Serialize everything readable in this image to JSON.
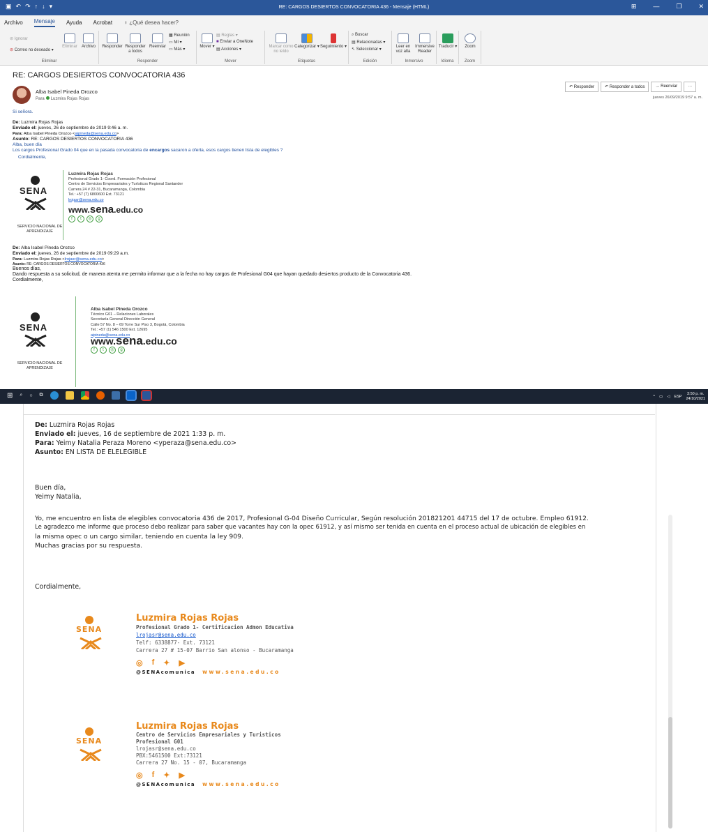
{
  "window": {
    "title": "RE: CARGOS DESIERTOS CONVOCATORIA 436 - Mensaje (HTML)"
  },
  "menu": {
    "tabs": [
      "Archivo",
      "Mensaje",
      "Ayuda",
      "Acrobat"
    ],
    "active": "Mensaje",
    "search_placeholder": "¿Qué desea hacer?"
  },
  "ribbon": {
    "groups": {
      "eliminar": "Eliminar",
      "responder": "Responder",
      "mover": "Mover",
      "etiquetas": "Etiquetas",
      "edicion": "Edición",
      "inmersivo": "Inmersivo",
      "idioma": "Idioma",
      "zoom": "Zoom"
    },
    "ignorar": "Ignorar",
    "correo_no_deseado": "Correo no deseado",
    "eliminar_btn": "Eliminar",
    "archivo_btn": "Archivo",
    "responder_btn": "Responder",
    "responder_todos": "Responder a todos",
    "reenviar": "Reenviar",
    "reunion": "Reunión",
    "mi": "MI",
    "mas": "Más",
    "mover_btn": "Mover",
    "reglas": "Reglas",
    "onenote": "Enviar a OneNote",
    "acciones": "Acciones",
    "marcar_no_leido": "Marcar como no leído",
    "categorizar": "Categorizar",
    "seguimiento": "Seguimiento",
    "buscar": "Buscar",
    "relacionadas": "Relacionadas",
    "seleccionar": "Seleccionar",
    "leer_voz_alta": "Leer en voz alta",
    "immersive_reader": "Immersive Reader",
    "traducir": "Traducir",
    "zoom_btn": "Zoom"
  },
  "message": {
    "subject": "RE: CARGOS DESIERTOS CONVOCATORIA 436",
    "sender": "Alba Isabel Pineda Orozco",
    "to_label": "Para",
    "recipient": "Luzmira Rojas Rojas",
    "date": "jueves 26/09/2019 9:57 a. m.",
    "actions": {
      "reply": "Responder",
      "reply_all": "Responder a todos",
      "forward": "Reenviar",
      "more": "···"
    },
    "reply_text": "Si señora."
  },
  "quoted1": {
    "from_label": "De:",
    "from": "Luzmira Rojas Rojas",
    "sent_label": "Enviado el:",
    "sent": "jueves, 26 de septiembre de 2019 9:46 a. m.",
    "to_label": "Para:",
    "to_name": "Alba Isabel Pineda Orozco <",
    "to_email": "aipineda@sena.edu.co",
    "to_close": ">",
    "subject_label": "Asunto:",
    "subject": "RE: CARGOS DESIERTOS CONVOCATORIA 436",
    "greeting": "Alba, buen día",
    "body_pre": "Los cargos Profesional Grado 04 que en la pasada convocatoria de ",
    "body_bold": "encargos",
    "body_post": " sacaron a oferta, esos cargos tienen lista de elegibles ?",
    "closing": "Cordialmente,"
  },
  "signature1": {
    "logo_word": "SENA",
    "logo_caption": "SERVICIO NACIONAL DE APRENDIZAJE",
    "name": "Luzmira Rojas Rojas",
    "lines": [
      "Profesional Grado 1- Coord. Formación Profesional",
      "Centro de Servicios Empresariales y Turísticos Regional Santander",
      "Carrera 24 # 22-31, Bucaramanga, Colombia",
      "Tel.: +57 (7) 6800600 Ext. 73121"
    ],
    "email": "lrojasr@sena.edu.co",
    "web_prefix": "www.",
    "web_bold": "sena",
    "web_suffix": ".edu.co"
  },
  "quoted2": {
    "from_label": "De:",
    "from": "Alba Isabel Pineda Orozco",
    "sent_label": "Enviado el:",
    "sent": "jueves, 26 de septiembre de 2019 09:29 a.m.",
    "to_label": "Para:",
    "to_name": "Luzmira Rojas Rojas <",
    "to_email": "lrojasr@sena.edu.co",
    "to_close": ">",
    "subject_label": "Asunto:",
    "subject": "RE: CARGOS DESIERTOS CONVOCATORIA 436",
    "greeting": "Buenos días,",
    "body": "Dando respuesta a su solicitud, de manera atenta me permito informar que a la fecha no hay cargos de Profesional G04 que hayan quedado desiertos producto de la Convocatoria 436.",
    "closing": "Cordialmente,"
  },
  "signature2": {
    "logo_word": "SENA",
    "logo_caption": "SERVICIO NACIONAL DE APRENDIZAJE",
    "name": "Alba Isabel Pineda Orozco",
    "lines": [
      "Técnico G01 – Relaciones Laborales",
      "Secretaría General Dirección General",
      "Calle 57 No. 8 – 69 Torre Sur Piso 3, Bogotá, Colombia",
      "Tel.: +57 (1) 546 1500 Ext. 12695"
    ],
    "email": "aipineda@sena.edu.co",
    "web_prefix": "www.",
    "web_bold": "sena",
    "web_suffix": ".edu.co"
  },
  "taskbar": {
    "lang": "ESP",
    "time": "3:50 p. m.",
    "date": "24/10/2021"
  },
  "lower": {
    "from_label": "De:",
    "from": "Luzmira Rojas Rojas",
    "sent_label": "Enviado el:",
    "sent": "jueves, 16 de septiembre de 2021 1:33 p. m.",
    "to_label": "Para:",
    "to": "Yeimy Natalia Peraza Moreno <yperaza@sena.edu.co>",
    "subject_label": "Asunto:",
    "subject": "EN LISTA DE ELELEGIBLE",
    "greeting1": "Buen día,",
    "greeting2": "Yeimy Natalia,",
    "p1": "Yo, me encuentro en lista de elegibles  convocatoria 436 de 2017,   Profesional  G-04   Diseño Curricular,  Según resolución  201821201 44715 del 17 de octubre. Empleo 61912.",
    "p2": "Le agradezco me informe que proceso debo realizar para saber que vacantes hay con la opec 61912, y así mismo ser tenida en cuenta  en el proceso actual de ubicación de elegibles en",
    "p3": "la misma opec  o un cargo similar, teniendo en cuenta  la ley 909.",
    "p4": "Muchas gracias por su respuesta.",
    "closing": "Cordialmente,"
  },
  "signature3": {
    "logo_word": "SENA",
    "name": "Luzmira Rojas Rojas",
    "title": "Profesional Grado 1- Certificacion Admon Educativa",
    "email": "lrojasr@sena.edu.co",
    "phone": "Telf: 6338877- Ext. 73121",
    "address": "Carrera 27 # 15-07 Barrio San alonso - Bucaramanga",
    "handle": "@SENAcomunica",
    "web": "www.sena.edu.co"
  },
  "signature4": {
    "logo_word": "SENA",
    "name": "Luzmira Rojas Rojas",
    "lines": [
      "Centro de Servicios Empresariales y Turisticos",
      "Profesional G01",
      "lrojasr@sena.edu.co",
      "PBX:5461500 Ext:73121",
      "Carrera 27 No. 15 - 07, Bucaramanga"
    ],
    "handle": "@SENAcomunica",
    "web": "www.sena.edu.co"
  },
  "colors": {
    "outlook_blue": "#2b579a",
    "sena_green": "#3a9a3a",
    "sena_orange": "#e8891c",
    "taskbar": "#1b2433"
  }
}
